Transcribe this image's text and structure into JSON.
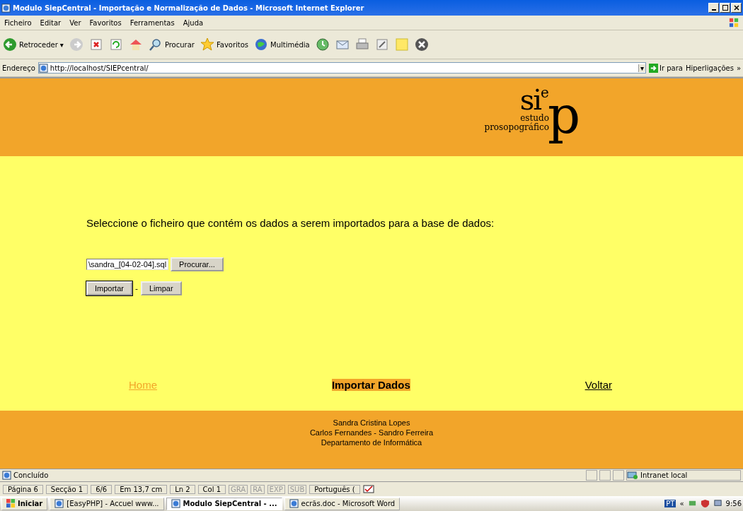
{
  "window": {
    "title": "Modulo SiepCentral - Importação e Normalização de Dados - Microsoft Internet Explorer"
  },
  "menu": [
    "Ficheiro",
    "Editar",
    "Ver",
    "Favoritos",
    "Ferramentas",
    "Ajuda"
  ],
  "toolbar": {
    "back": "Retroceder",
    "caret": "▾",
    "search": "Procurar",
    "favorites": "Favoritos",
    "media": "Multimédia"
  },
  "address": {
    "label": "Endereço",
    "url": "http://localhost/SIEPcentral/",
    "caret": "▾",
    "go": "Ir para",
    "links": "Hiperligações",
    "more": "»"
  },
  "logo": {
    "letters": [
      "s",
      "i",
      "e",
      "p"
    ],
    "line1": "estudo",
    "line2": "prosopográfico"
  },
  "form": {
    "prompt": "Seleccione o ficheiro que contém os dados a serem importados para a base de dados:",
    "file_value": "\\sandra_[04-02-04].sql",
    "browse": "Procurar...",
    "submit": "Importar",
    "separator": "-",
    "reset": "Limpar"
  },
  "nav": [
    {
      "label": "Home",
      "selected": false,
      "visited": true
    },
    {
      "label": "Importar Dados",
      "selected": true,
      "visited": false
    },
    {
      "label": "Voltar",
      "selected": false,
      "visited": false
    }
  ],
  "footer": [
    "Sandra Cristina Lopes",
    "Carlos Fernandes - Sandro Ferreira",
    "Departamento de Informática"
  ],
  "status": {
    "text": "Concluído",
    "zone": "Intranet local"
  },
  "word_status": {
    "cells": [
      "Página 6",
      "Secção 1",
      "6/6",
      "Em 13,7 cm",
      "Ln 2",
      "Col 1"
    ],
    "modes": [
      {
        "label": "GRA",
        "disabled": true
      },
      {
        "label": "RA",
        "disabled": true
      },
      {
        "label": "EXP",
        "disabled": true
      },
      {
        "label": "SUB",
        "disabled": true
      }
    ],
    "language": "Português ("
  },
  "taskbar": {
    "start": "Iniciar",
    "tasks": [
      {
        "label": "[EasyPHP] - Accuel www...",
        "selected": false
      },
      {
        "label": "Modulo SiepCentral - ...",
        "selected": true
      },
      {
        "label": "ecrãs.doc - Microsoft Word",
        "selected": false
      }
    ],
    "tray_lang": "PT",
    "tray_more": "«",
    "clock": "9:56"
  }
}
